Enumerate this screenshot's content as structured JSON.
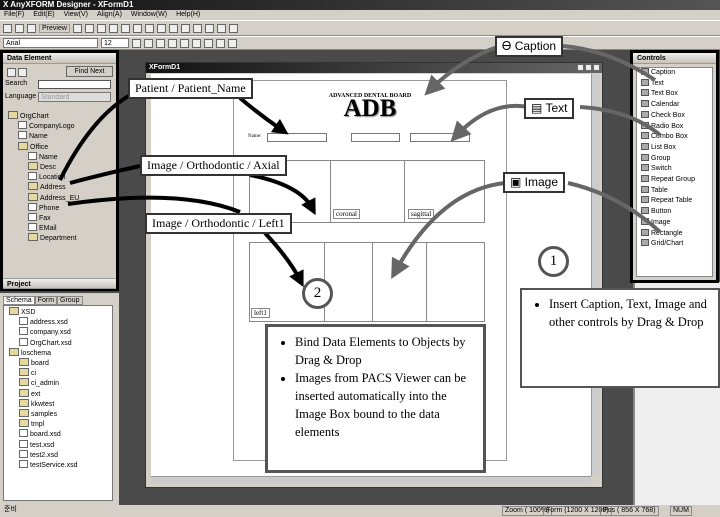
{
  "app": {
    "title": "AnyXFORM Designer - XFormD1"
  },
  "menu": [
    "File(F)",
    "Edit(E)",
    "View(V)",
    "Align(A)",
    "Window(W)",
    "Help(H)"
  ],
  "toolbar": {
    "preview_label": "Preview",
    "font": "Arial",
    "size": "12"
  },
  "data_element": {
    "title": "Data Element",
    "find_next": "Find Next",
    "search_label": "Search",
    "search_value": "",
    "language_label": "Language",
    "language_value": "Standard",
    "tree": [
      {
        "label": "OrgChart",
        "d": 0,
        "t": "fold"
      },
      {
        "label": "CompanyLogo",
        "d": 1,
        "t": "file"
      },
      {
        "label": "Name",
        "d": 1,
        "t": "file"
      },
      {
        "label": "Office",
        "d": 1,
        "t": "fold"
      },
      {
        "label": "Name",
        "d": 2,
        "t": "file"
      },
      {
        "label": "Desc",
        "d": 2,
        "t": "fold"
      },
      {
        "label": "Location",
        "d": 2,
        "t": "file"
      },
      {
        "label": "Address",
        "d": 2,
        "t": "fold"
      },
      {
        "label": "Address_EU",
        "d": 2,
        "t": "fold"
      },
      {
        "label": "Phone",
        "d": 2,
        "t": "file"
      },
      {
        "label": "Fax",
        "d": 2,
        "t": "file"
      },
      {
        "label": "EMail",
        "d": 2,
        "t": "file"
      },
      {
        "label": "Department",
        "d": 2,
        "t": "fold"
      }
    ],
    "project_label": "Project"
  },
  "schema": {
    "tabs": [
      "Schema",
      "Form",
      "Group"
    ],
    "tree": [
      {
        "label": "XSD",
        "d": 0,
        "t": "fold"
      },
      {
        "label": "address.xsd",
        "d": 1,
        "t": "file"
      },
      {
        "label": "company.xsd",
        "d": 1,
        "t": "file"
      },
      {
        "label": "OrgChart.xsd",
        "d": 1,
        "t": "file"
      },
      {
        "label": "loschema",
        "d": 0,
        "t": "fold"
      },
      {
        "label": "board",
        "d": 1,
        "t": "fold"
      },
      {
        "label": "ci",
        "d": 1,
        "t": "fold"
      },
      {
        "label": "ci_admin",
        "d": 1,
        "t": "fold"
      },
      {
        "label": "ext",
        "d": 1,
        "t": "fold"
      },
      {
        "label": "kkwtest",
        "d": 1,
        "t": "fold"
      },
      {
        "label": "samples",
        "d": 1,
        "t": "fold"
      },
      {
        "label": "tmpl",
        "d": 1,
        "t": "fold"
      },
      {
        "label": "board.xsd",
        "d": 1,
        "t": "file"
      },
      {
        "label": "test.xsd",
        "d": 1,
        "t": "file"
      },
      {
        "label": "test2.xsd",
        "d": 1,
        "t": "file"
      },
      {
        "label": "testService.xsd",
        "d": 1,
        "t": "file"
      }
    ]
  },
  "controls": {
    "title": "Controls",
    "items": [
      "Caption",
      "Text",
      "Text Box",
      "Calendar",
      "Check Box",
      "Radio Box",
      "Combo Box",
      "List Box",
      "Group",
      "Switch",
      "Repeat Group",
      "Table",
      "Repeat Table",
      "Button",
      "Image",
      "Rectangle",
      "Grid/Chart"
    ]
  },
  "form_window": {
    "title": "XFormD1",
    "header_small": "ADVANCED DENTAL BOARD",
    "header_big": "ADB",
    "name_label": "Name:",
    "image_labels": {
      "coronal": "coronal",
      "sagittal": "sagittal",
      "left1": "left1"
    }
  },
  "callouts": {
    "caption": "Caption",
    "text": "Text",
    "image": "Image",
    "patient": "Patient / Patient_Name",
    "axial": "Image / Orthodontic / Axial",
    "left1": "Image / Orthodontic / Left1",
    "step1": "1",
    "step2": "2",
    "insert_note": "Insert Caption, Text, Image and other controls by Drag & Drop",
    "bind_notes": [
      "Bind Data Elements to Objects by Drag & Drop",
      "Images from PACS Viewer can be inserted automatically into the Image Box bound to the data elements"
    ]
  },
  "status": {
    "left": "준비",
    "zoom": "Zoom ( 100%)",
    "form": "Form (1200 X 1200)",
    "pos": "Pos ( 856 X  768)",
    "num": "NUM"
  }
}
